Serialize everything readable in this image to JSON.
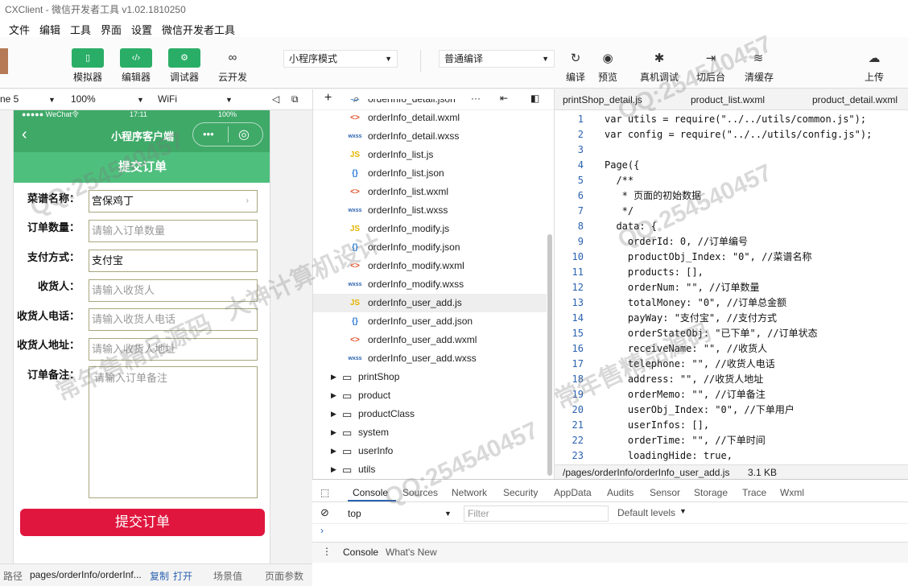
{
  "window": {
    "title": "CXClient - 微信开发者工具 v1.02.1810250"
  },
  "menu": [
    "文件",
    "编辑",
    "工具",
    "界面",
    "设置",
    "微信开发者工具"
  ],
  "toolbar": {
    "simulator": "模拟器",
    "editor": "编辑器",
    "debugger": "调试器",
    "cloud": "云开发",
    "mode_select": "小程序模式",
    "compile_select": "普通编译",
    "compile": "编译",
    "preview": "预览",
    "real_debug": "真机调试",
    "backend": "切后台",
    "clear_cache": "清缓存",
    "upload": "上传"
  },
  "sim_bar": {
    "device": "ne 5",
    "zoom": "100%",
    "network": "WiFi"
  },
  "phone": {
    "status_left": "●●●●● WeChat令",
    "status_time": "17:11",
    "status_battery": "100%",
    "nav_title": "小程序客户端",
    "header": "提交订单",
    "fields": [
      {
        "label": "菜谱名称：",
        "value": "宫保鸡丁",
        "placeholder": ""
      },
      {
        "label": "订单数量：",
        "value": "",
        "placeholder": "请输入订单数量"
      },
      {
        "label": "支付方式：",
        "value": "支付宝",
        "placeholder": ""
      },
      {
        "label": "收货人：",
        "value": "",
        "placeholder": "请输入收货人"
      },
      {
        "label": "收货人电话：",
        "value": "",
        "placeholder": "请输入收货人电话"
      },
      {
        "label": "收货人地址：",
        "value": "",
        "placeholder": "请输入收货人地址"
      }
    ],
    "memo_label": "订单备注：",
    "memo_placeholder": "请输入订单备注",
    "submit": "提交订单"
  },
  "sim_footer": {
    "path_label": "路径",
    "path": "pages/orderInfo/orderInf...",
    "copy": "复制",
    "open": "打开",
    "scene": "场景值",
    "params": "页面参数"
  },
  "file_tree": [
    {
      "icon": "<>",
      "name": "orderInfo_detail.json",
      "kind": "json"
    },
    {
      "icon": "<>",
      "name": "orderInfo_detail.wxml",
      "kind": "wxml"
    },
    {
      "icon": "wxss",
      "name": "orderInfo_detail.wxss",
      "kind": "wxss"
    },
    {
      "icon": "JS",
      "name": "orderInfo_list.js",
      "kind": "js"
    },
    {
      "icon": "{}",
      "name": "orderInfo_list.json",
      "kind": "json"
    },
    {
      "icon": "<>",
      "name": "orderInfo_list.wxml",
      "kind": "wxml"
    },
    {
      "icon": "wxss",
      "name": "orderInfo_list.wxss",
      "kind": "wxss"
    },
    {
      "icon": "JS",
      "name": "orderInfo_modify.js",
      "kind": "js"
    },
    {
      "icon": "{}",
      "name": "orderInfo_modify.json",
      "kind": "json"
    },
    {
      "icon": "<>",
      "name": "orderInfo_modify.wxml",
      "kind": "wxml"
    },
    {
      "icon": "wxss",
      "name": "orderInfo_modify.wxss",
      "kind": "wxss"
    },
    {
      "icon": "JS",
      "name": "orderInfo_user_add.js",
      "kind": "js"
    },
    {
      "icon": "{}",
      "name": "orderInfo_user_add.json",
      "kind": "json"
    },
    {
      "icon": "<>",
      "name": "orderInfo_user_add.wxml",
      "kind": "wxml"
    },
    {
      "icon": "wxss",
      "name": "orderInfo_user_add.wxss",
      "kind": "wxss"
    }
  ],
  "folders": [
    "printShop",
    "product",
    "productClass",
    "system",
    "userInfo",
    "utils"
  ],
  "editor": {
    "tabs": [
      "printShop_detail.js",
      "product_list.wxml",
      "product_detail.wxml"
    ],
    "lines": [
      "var utils = require(\"../../utils/common.js\");",
      "var config = require(\"../../utils/config.js\");",
      "",
      "Page({",
      "  /**",
      "   * 页面的初始数据",
      "   */",
      "  data: {",
      "    orderId: 0, //订单编号",
      "    productObj_Index: \"0\", //菜谱名称",
      "    products: [],",
      "    orderNum: \"\", //订单数量",
      "    totalMoney: \"0\", //订单总金额",
      "    payWay: \"支付宝\", //支付方式",
      "    orderStateObj: \"已下单\", //订单状态",
      "    receiveName: \"\", //收货人",
      "    telephone: \"\", //收货人电话",
      "    address: \"\", //收货人地址",
      "    orderMemo: \"\", //订单备注",
      "    userObj_Index: \"0\", //下单用户",
      "    userInfos: [],",
      "    orderTime: \"\", //下单时间",
      "    loadingHide: true,"
    ],
    "status_path": "/pages/orderInfo/orderInfo_user_add.js",
    "status_size": "3.1 KB"
  },
  "devtools": {
    "tabs": [
      "Console",
      "Sources",
      "Network",
      "Security",
      "AppData",
      "Audits",
      "Sensor",
      "Storage",
      "Trace",
      "Wxml"
    ],
    "context": "top",
    "filter_placeholder": "Filter",
    "levels": "Default levels",
    "bottom_tabs": [
      "Console",
      "What's New"
    ]
  },
  "watermarks": [
    "常年售精品源码",
    "QQ:254540457",
    "大神计算机设计"
  ],
  "colors": {
    "green": "#3fa968",
    "submit_red": "#e0163e",
    "toolbar_green": "#2aae67"
  }
}
